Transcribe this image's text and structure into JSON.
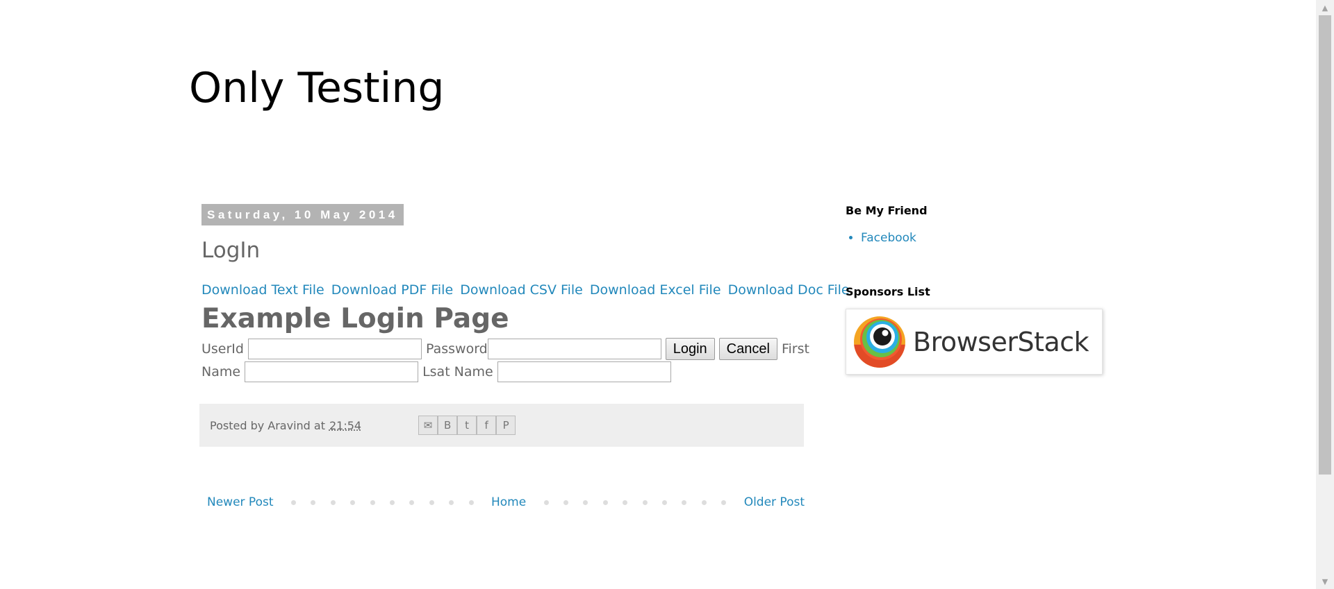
{
  "blog": {
    "title": "Only Testing"
  },
  "post": {
    "date": "Saturday, 10 May 2014",
    "title": "LogIn",
    "downloads": [
      "Download Text File",
      "Download PDF File",
      "Download CSV File",
      "Download Excel File",
      "Download Doc File"
    ],
    "heading": "Example Login Page",
    "form": {
      "userid_label": "UserId",
      "password_label": "Password",
      "login_button": "Login",
      "cancel_button": "Cancel",
      "first_name_label_part1": "First",
      "first_name_label_part2": "Name",
      "last_name_label": "Lsat Name"
    },
    "footer": {
      "posted_by": "Posted by Aravind at",
      "time": "21:54",
      "share_icons": [
        "email-icon",
        "blogger-icon",
        "twitter-icon",
        "facebook-icon",
        "pinterest-icon"
      ]
    }
  },
  "pager": {
    "newer": "Newer Post",
    "home": "Home",
    "older": "Older Post"
  },
  "sidebar": {
    "friend_heading": "Be My Friend",
    "friend_links": [
      "Facebook"
    ],
    "sponsors_heading": "Sponsors List",
    "sponsor_name": "BrowserStack"
  },
  "colors": {
    "link": "#2288bb",
    "date_bg": "#b3b3b3",
    "footer_bg": "#eeeeee"
  }
}
